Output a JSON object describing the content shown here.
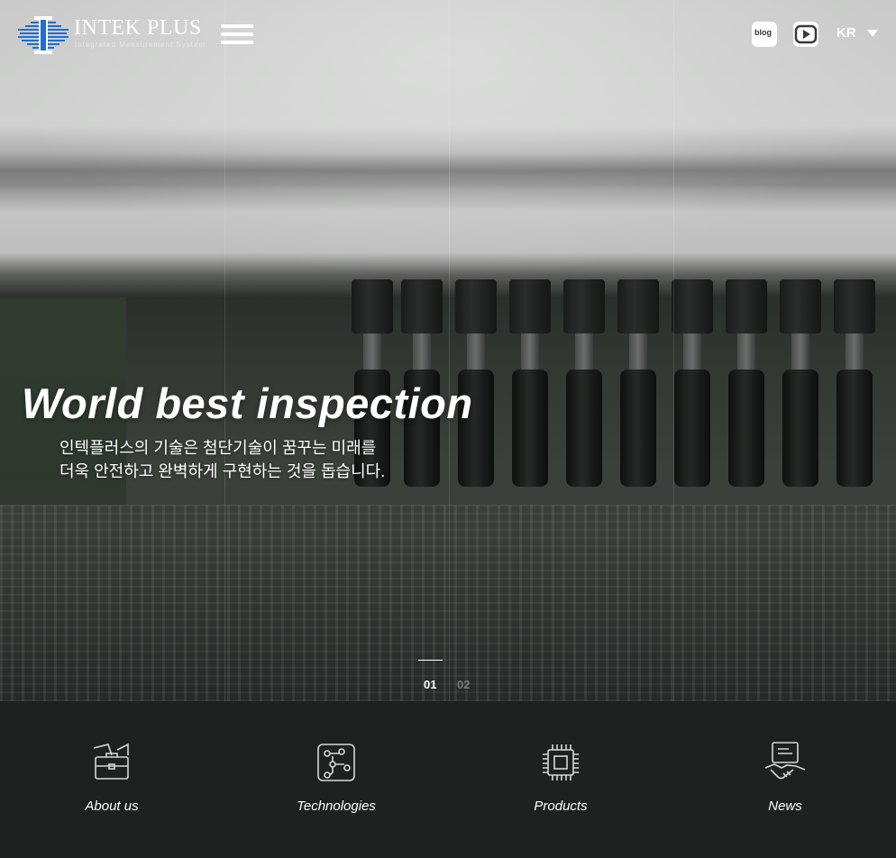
{
  "header": {
    "logo_text": "INTEK PLUS",
    "logo_subtitle": "Integrated Measurement System",
    "blog_label": "blog",
    "language": "KR"
  },
  "hero": {
    "title": "World best inspection",
    "desc_line1": "인텍플러스의 기술은 첨단기술이 꿈꾸는 미래를",
    "desc_line2": "더욱 안전하고 완벽하게 구현하는 것을 돕습니다."
  },
  "pager": {
    "page1": "01",
    "page2": "02"
  },
  "quick_menu": [
    {
      "label": "About us",
      "icon": "briefcase-icon"
    },
    {
      "label": "Technologies",
      "icon": "circuit-icon"
    },
    {
      "label": "Products",
      "icon": "chip-icon"
    },
    {
      "label": "News",
      "icon": "handshake-icon"
    }
  ],
  "colors": {
    "background_dark": "#1f2020",
    "logo_blue": "#1e6fd0"
  }
}
